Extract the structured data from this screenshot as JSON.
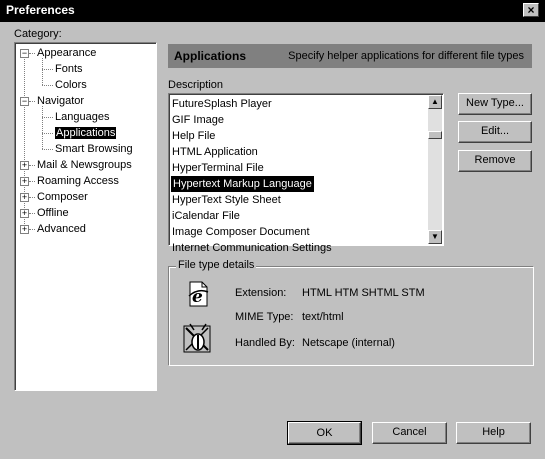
{
  "window": {
    "title": "Preferences",
    "close_glyph": "×"
  },
  "category": {
    "label": "Category:"
  },
  "tree": [
    {
      "label": "Appearance",
      "level": 0,
      "expander": "−"
    },
    {
      "label": "Fonts",
      "level": 1
    },
    {
      "label": "Colors",
      "level": 1
    },
    {
      "label": "Navigator",
      "level": 0,
      "expander": "−"
    },
    {
      "label": "Languages",
      "level": 1
    },
    {
      "label": "Applications",
      "level": 1,
      "selected": true
    },
    {
      "label": "Smart Browsing",
      "level": 1
    },
    {
      "label": "Mail & Newsgroups",
      "level": 0,
      "expander": "+"
    },
    {
      "label": "Roaming Access",
      "level": 0,
      "expander": "+"
    },
    {
      "label": "Composer",
      "level": 0,
      "expander": "+"
    },
    {
      "label": "Offline",
      "level": 0,
      "expander": "+"
    },
    {
      "label": "Advanced",
      "level": 0,
      "expander": "+"
    }
  ],
  "header": {
    "title": "Applications",
    "description": "Specify helper applications for different file types"
  },
  "description_label": "Description",
  "list": {
    "items": [
      "FutureSplash Player",
      "GIF Image",
      "Help File",
      "HTML Application",
      "HyperTerminal File",
      "Hypertext Markup Language",
      "HyperText Style Sheet",
      "iCalendar File",
      "Image Composer Document",
      "Internet Communication Settings"
    ],
    "selected_index": 5
  },
  "buttons": {
    "new_type": "New Type...",
    "edit": "Edit...",
    "remove": "Remove"
  },
  "details": {
    "group_label": "File type details",
    "extension_label": "Extension:",
    "extension_value": "HTML HTM SHTML STM",
    "mime_label": "MIME Type:",
    "mime_value": "text/html",
    "handled_label": "Handled By:",
    "handled_value": "Netscape (internal)",
    "file_icon": "ie-document-icon",
    "handler_icon": "netscape-icon"
  },
  "footer": {
    "ok": "OK",
    "cancel": "Cancel",
    "help": "Help"
  }
}
